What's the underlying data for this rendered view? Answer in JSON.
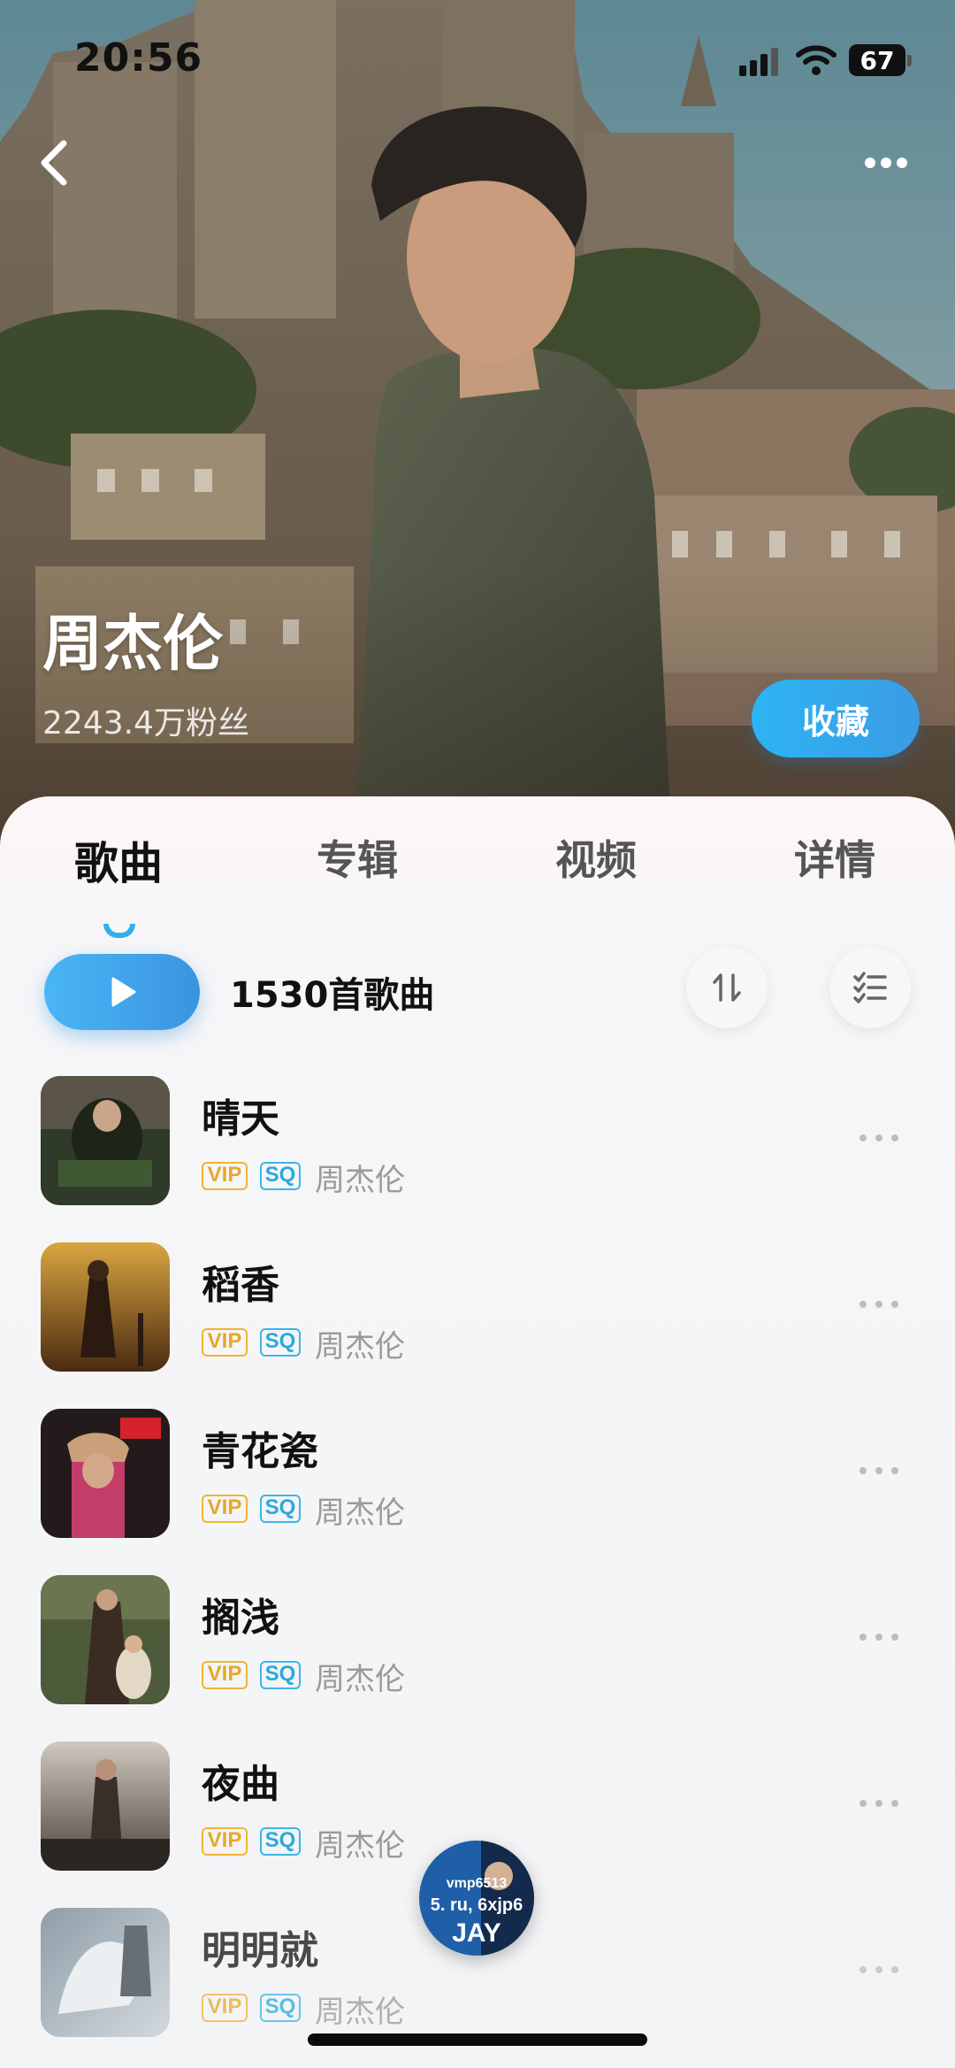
{
  "status_bar": {
    "time": "20:56",
    "battery": "67"
  },
  "artist": {
    "name": "周杰伦",
    "fans": "2243.4万粉丝",
    "collect_label": "收藏"
  },
  "tabs": [
    {
      "label": "歌曲",
      "active": true
    },
    {
      "label": "专辑",
      "active": false
    },
    {
      "label": "视频",
      "active": false
    },
    {
      "label": "详情",
      "active": false
    }
  ],
  "toolbar": {
    "song_count": "1530首歌曲"
  },
  "songs": [
    {
      "title": "晴天",
      "artist": "周杰伦",
      "vip": "VIP",
      "sq": "SQ"
    },
    {
      "title": "稻香",
      "artist": "周杰伦",
      "vip": "VIP",
      "sq": "SQ"
    },
    {
      "title": "青花瓷",
      "artist": "周杰伦",
      "vip": "VIP",
      "sq": "SQ"
    },
    {
      "title": "搁浅",
      "artist": "周杰伦",
      "vip": "VIP",
      "sq": "SQ"
    },
    {
      "title": "夜曲",
      "artist": "周杰伦",
      "vip": "VIP",
      "sq": "SQ"
    },
    {
      "title": "明明就",
      "artist": "周杰伦",
      "vip": "VIP",
      "sq": "SQ"
    }
  ],
  "mini_player": {
    "line1": "vmp6513",
    "line2": "5. ru, 6xjp6",
    "line3": "JAY"
  },
  "colors": {
    "accent": "#2fb0ee",
    "vip": "#e6a82a",
    "sq": "#2aa9dd"
  },
  "icons": [
    "back-icon",
    "more-icon",
    "play-icon",
    "sort-icon",
    "multi-select-icon",
    "signal-icon",
    "wifi-icon",
    "battery-icon"
  ]
}
